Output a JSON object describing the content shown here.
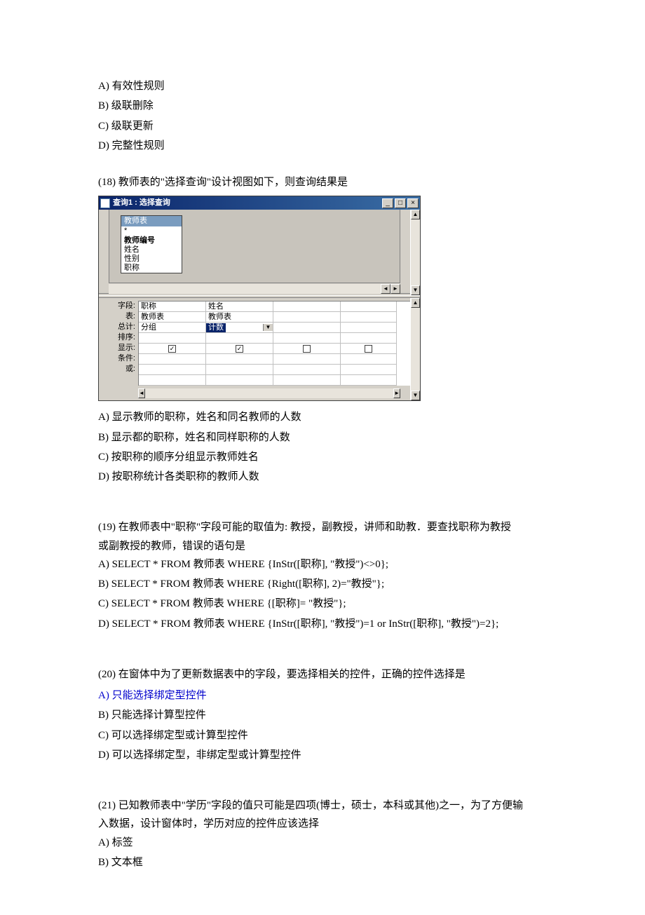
{
  "q17_options": {
    "a": "A)  有效性规则",
    "b": "B)  级联删除",
    "c": "C)  级联更新",
    "d": "D)  完整性规则"
  },
  "q18": {
    "text": "(18)  教师表的\"选择查询\"设计视图如下，则查询结果是",
    "window_title": "查询1 : 选择查询",
    "fieldlist_title": "教师表",
    "fieldlist": [
      "*",
      "教师编号",
      "姓名",
      "性别",
      "职称"
    ],
    "grid_labels": [
      "字段:",
      "表:",
      "总计:",
      "排序:",
      "显示:",
      "条件:",
      "或:",
      ""
    ],
    "grid": {
      "field": [
        "职称",
        "姓名",
        "",
        ""
      ],
      "table": [
        "教师表",
        "教师表",
        "",
        ""
      ],
      "total": [
        "分组",
        "计数",
        "",
        ""
      ],
      "show": [
        true,
        true,
        false,
        false
      ]
    },
    "options": {
      "a": "A)  显示教师的职称，姓名和同名教师的人数",
      "b": "B)  显示都的职称，姓名和同样职称的人数",
      "c": "C)  按职称的顺序分组显示教师姓名",
      "d": "D)    按职称统计各类职称的教师人数"
    }
  },
  "q19": {
    "text1": "(19)  在教师表中\"职称\"字段可能的取值为: 教授，副教授，讲师和助教．要查找职称为教授",
    "text2": "或副教授的教师，错误的语句是",
    "a": "A) SELECT * FROM  教师表  WHERE {InStr([职称], \"教授\")<>0};",
    "b": "B) SELECT * FROM  教师表  WHERE {Right([职称], 2)=\"教授\"};",
    "c": "C) SELECT * FROM  教师表  WHERE {[职称]= \"教授\"};",
    "d": "D) SELECT * FROM  教师表  WHERE {InStr([职称], \"教授\")=1 or InStr([职称], \"教授\")=2};"
  },
  "q20": {
    "text": "(20)  在窗体中为了更新数据表中的字段，要选择相关的控件，正确的控件选择是",
    "a": "A)  只能选择绑定型控件",
    "b": "B)  只能选择计算型控件",
    "c": "C)  可以选择绑定型或计算型控件",
    "d": "D)    可以选择绑定型，非绑定型或计算型控件"
  },
  "q21": {
    "text1": "(21)  已知教师表中\"学历\"字段的值只可能是四项(博士，硕士，本科或其他)之一，为了方便输",
    "text2": "入数据，设计窗体时，学历对应的控件应该选择",
    "a": "A)  标签",
    "b": "B)  文本框"
  }
}
